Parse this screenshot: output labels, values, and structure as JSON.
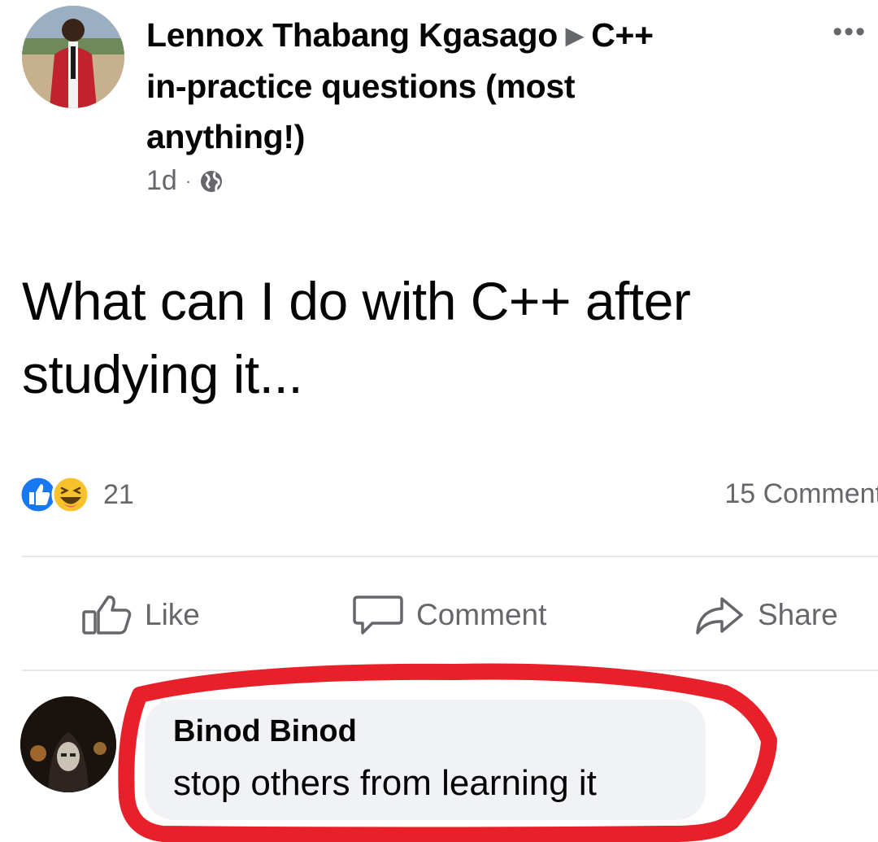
{
  "post": {
    "author": "Lennox Thabang Kgasago",
    "arrow": "▶",
    "group_line1": "C++",
    "group_line2": "in-practice questions (most",
    "group_line3": "anything!)",
    "time": "1d",
    "separator": "·",
    "privacy_icon": "globe-icon",
    "more_label": "•••",
    "body_line1": "What can I do with C++ after",
    "body_line2": "studying it..."
  },
  "reactions": {
    "icons": [
      "like-reaction-icon",
      "haha-reaction-icon"
    ],
    "count": "21",
    "comments": "15 Comment"
  },
  "actions": {
    "like": "Like",
    "comment": "Comment",
    "share": "Share"
  },
  "comment": {
    "author": "Binod Binod",
    "text": "stop others from learning it"
  },
  "colors": {
    "facebook_blue": "#1877f2",
    "secondary_text": "#65676b",
    "highlight_ring": "#e8202a",
    "bubble": "#f0f2f5"
  }
}
